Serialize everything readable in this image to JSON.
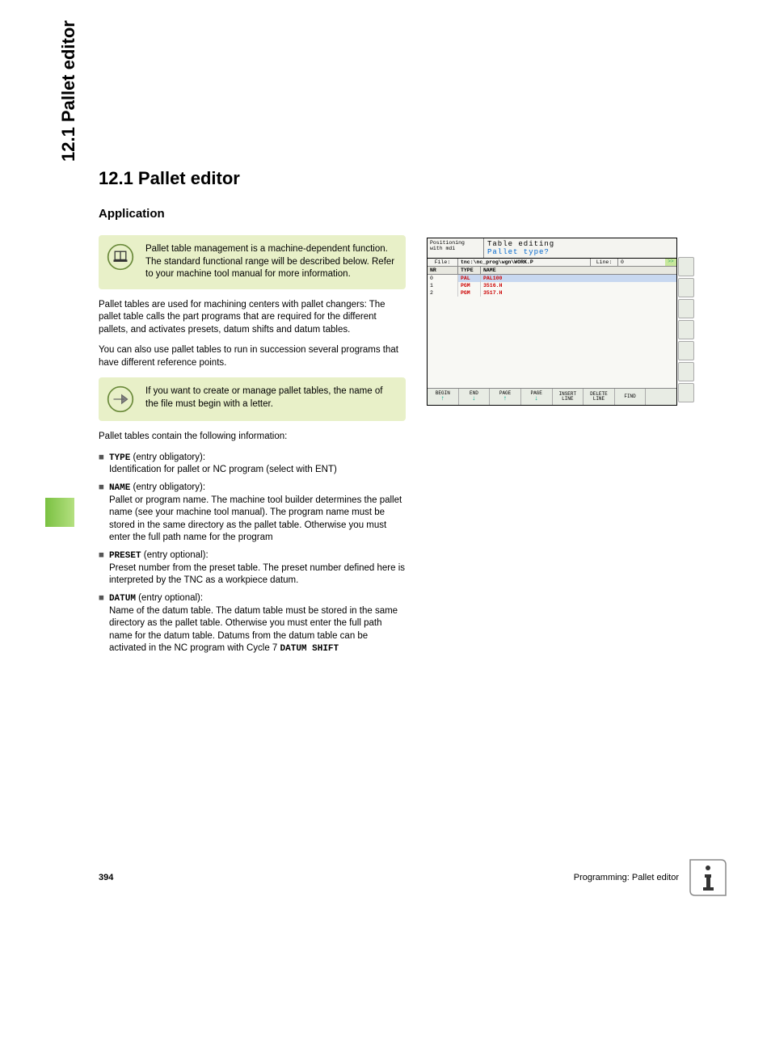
{
  "side_tab": "12.1 Pallet editor",
  "heading": "12.1 Pallet editor",
  "subheading": "Application",
  "note1": "Pallet table management is a machine-dependent function. The standard functional range will be described below. Refer to your machine tool manual for more information.",
  "para1": "Pallet tables are used for machining centers with pallet changers: The pallet table calls the part programs that are required for the different pallets, and activates presets, datum shifts and datum tables.",
  "para2": "You can also use pallet tables to run in succession several programs that have different reference points.",
  "note2": "If you want to create or manage pallet tables, the name of the file must begin with a letter.",
  "para3": "Pallet tables contain the following information:",
  "list": [
    {
      "term": "TYPE",
      "qual": " (entry obligatory):",
      "desc": "Identification for pallet or NC program (select with ENT)"
    },
    {
      "term": "NAME",
      "qual": " (entry obligatory):",
      "desc": "Pallet or program name. The machine tool builder determines the pallet name (see your machine tool manual). The program name must be stored in the same directory as the pallet table. Otherwise you must enter the full path name for the program"
    },
    {
      "term": "PRESET",
      "qual": " (entry optional):",
      "desc": "Preset number from the preset table. The preset number defined here is interpreted by the TNC as a workpiece datum."
    },
    {
      "term": "DATUM",
      "qual": " (entry optional):",
      "desc_pre": "Name of the datum table. The datum table must be stored in the same directory as the pallet table. Otherwise you must enter the full path name for the datum table. Datums from the datum table can be activated in the NC program with Cycle 7 ",
      "desc_mono": "DATUM SHIFT"
    }
  ],
  "screenshot": {
    "mode_l1": "Positioning",
    "mode_l2": "with mdi",
    "title1": "Table editing",
    "title2": "Pallet type?",
    "file_label": "File:",
    "file_path": "tnc:\\nc_prog\\wgn\\WORK.P",
    "line_label": "Line:",
    "line_value": "0",
    "go": ">>",
    "cols": {
      "nr": "NR",
      "type": "TYPE",
      "name": "NAME"
    },
    "rows": [
      {
        "nr": "0",
        "type": "PAL",
        "name": "PAL100"
      },
      {
        "nr": "1",
        "type": "PGM",
        "name": "3516.H"
      },
      {
        "nr": "2",
        "type": "PGM",
        "name": "3517.H"
      }
    ],
    "softkeys": [
      {
        "l1": "BEGIN",
        "arrow": "up"
      },
      {
        "l1": "END",
        "arrow": "down"
      },
      {
        "l1": "PAGE",
        "arrow": "up"
      },
      {
        "l1": "PAGE",
        "arrow": "down"
      },
      {
        "l1": "INSERT",
        "l2": "LINE"
      },
      {
        "l1": "DELETE",
        "l2": "LINE"
      },
      {
        "l1": "FIND"
      }
    ]
  },
  "footer": {
    "page": "394",
    "chapter": "Programming: Pallet editor"
  }
}
